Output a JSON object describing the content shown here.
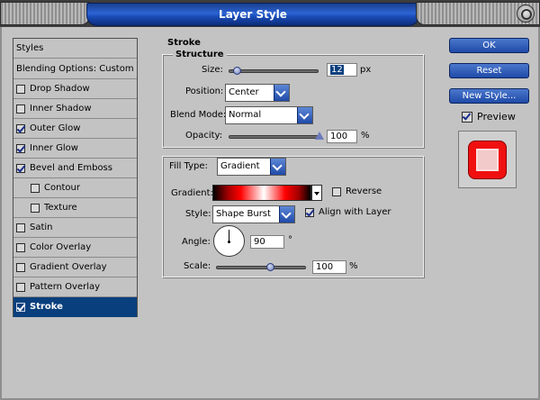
{
  "window": {
    "title": "Layer Style"
  },
  "styles_list": {
    "header": "Styles",
    "blending": "Blending Options: Custom",
    "items": [
      {
        "label": "Drop Shadow",
        "checked": false,
        "indent": false
      },
      {
        "label": "Inner Shadow",
        "checked": false,
        "indent": false
      },
      {
        "label": "Outer Glow",
        "checked": true,
        "indent": false
      },
      {
        "label": "Inner Glow",
        "checked": true,
        "indent": false
      },
      {
        "label": "Bevel and Emboss",
        "checked": true,
        "indent": false
      },
      {
        "label": "Contour",
        "checked": false,
        "indent": true
      },
      {
        "label": "Texture",
        "checked": false,
        "indent": true
      },
      {
        "label": "Satin",
        "checked": false,
        "indent": false
      },
      {
        "label": "Color Overlay",
        "checked": false,
        "indent": false
      },
      {
        "label": "Gradient Overlay",
        "checked": false,
        "indent": false
      },
      {
        "label": "Pattern Overlay",
        "checked": false,
        "indent": false
      },
      {
        "label": "Stroke",
        "checked": true,
        "indent": false,
        "selected": true
      }
    ]
  },
  "stroke": {
    "title": "Stroke",
    "structure": {
      "title": "Structure",
      "size_label": "Size:",
      "size_value": "12",
      "size_unit": "px",
      "size_fraction": 0.08,
      "position_label": "Position:",
      "position_value": "Center",
      "blend_mode_label": "Blend Mode:",
      "blend_mode_value": "Normal",
      "opacity_label": "Opacity:",
      "opacity_value": "100",
      "opacity_unit": "%",
      "opacity_fraction": 1.0
    },
    "fill": {
      "fill_type_label": "Fill Type:",
      "fill_type_value": "Gradient",
      "gradient_label": "Gradient:",
      "reverse_label": "Reverse",
      "reverse_checked": false,
      "style_label": "Style:",
      "style_value": "Shape Burst",
      "align_label": "Align with Layer",
      "align_checked": true,
      "angle_label": "Angle:",
      "angle_value": "90",
      "angle_unit": "°",
      "scale_label": "Scale:",
      "scale_value": "100",
      "scale_unit": "%",
      "scale_fraction": 0.6
    }
  },
  "buttons": {
    "ok": "OK",
    "reset": "Reset",
    "new_style": "New Style...",
    "preview_label": "Preview",
    "preview_checked": true
  },
  "colors": {
    "title_blue": "#2c64d4",
    "selected_row": "#0a3f7d",
    "stroke_red": "#f01010"
  }
}
